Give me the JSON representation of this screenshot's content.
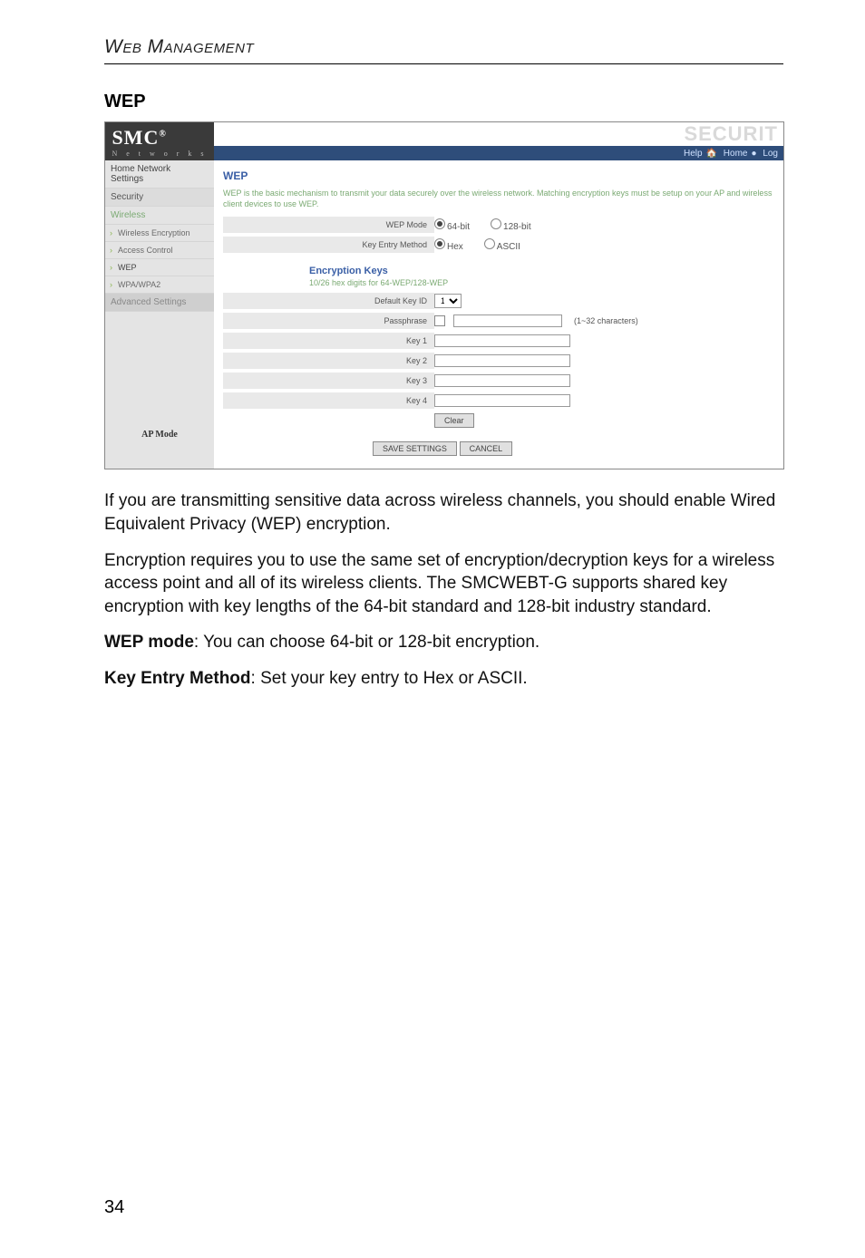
{
  "running_head": "Web Management",
  "section_heading": "WEP",
  "ui": {
    "logo": {
      "brand": "SMC",
      "reg": "®",
      "sub": "N e t w o r k s"
    },
    "watermark": "SECURIT",
    "stripe": {
      "help": "Help",
      "home": "Home",
      "log": "Log"
    },
    "sidebar": {
      "home_line1": "Home Network",
      "home_line2": "Settings",
      "security": "Security",
      "wireless": "Wireless",
      "sub_we": "Wireless Encryption",
      "sub_ac": "Access Control",
      "sub_wep": "WEP",
      "sub_wpa": "WPA/WPA2",
      "advanced": "Advanced Settings",
      "mode": "AP Mode"
    },
    "main": {
      "title": "WEP",
      "desc": "WEP is the basic mechanism to transmit your data securely over the wireless network. Matching encryption keys must be setup on your AP and wireless client devices to use WEP.",
      "wep_mode_label": "WEP Mode",
      "wep_64": "64-bit",
      "wep_128": "128-bit",
      "kem_label": "Key Entry Method",
      "kem_hex": "Hex",
      "kem_ascii": "ASCII",
      "enc_keys": "Encryption Keys",
      "enc_sub": "10/26 hex digits for 64-WEP/128-WEP",
      "def_key_label": "Default Key ID",
      "def_key_value": "1",
      "pass_label": "Passphrase",
      "pass_hint": "(1~32 characters)",
      "key1": "Key 1",
      "key2": "Key 2",
      "key3": "Key 3",
      "key4": "Key 4",
      "clear_btn": "Clear",
      "save_btn": "SAVE SETTINGS",
      "cancel_btn": "CANCEL"
    }
  },
  "body": {
    "p1": "If you are transmitting sensitive data across wireless channels, you should enable Wired Equivalent Privacy (WEP) encryption.",
    "p2": "Encryption requires you to use the same set of encryption/decryption keys for a wireless access point and all of its wireless clients. The SMCWEBT-G supports shared key encryption with key lengths of the 64-bit standard and 128-bit industry standard.",
    "p3_bold": "WEP mode",
    "p3_rest": ": You can choose 64-bit or 128-bit encryption.",
    "p4_bold": "Key Entry Method",
    "p4_rest": ": Set your key entry to Hex or ASCII."
  },
  "page_number": "34"
}
